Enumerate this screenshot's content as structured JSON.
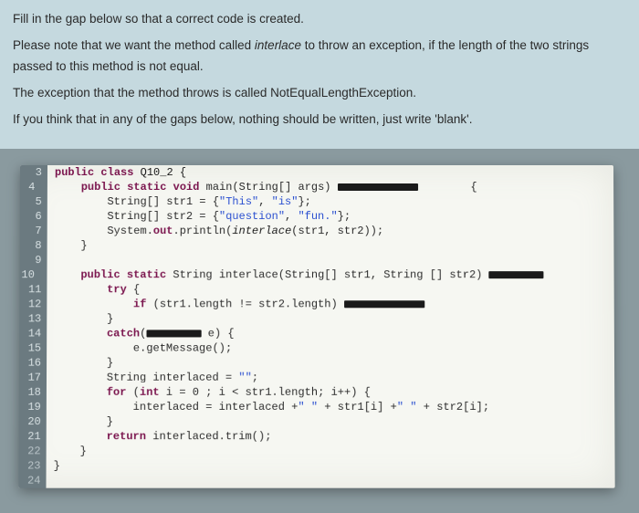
{
  "instructions": {
    "p1": "Fill in the gap below so that a correct code is created.",
    "p2a": "Please note that we want the method called ",
    "p2b": "interlace",
    "p2c": " to throw an exception, if the length of the two strings passed to this method is not equal.",
    "p3": "The exception that the method throws is called NotEqualLengthException.",
    "p4": "If you think that in any of the gaps below, nothing should be written, just write 'blank'."
  },
  "gutter": {
    "l3": "3",
    "l4": "4",
    "l5": "5",
    "l6": "6",
    "l7": "7",
    "l8": "8",
    "l9": "9",
    "l10": "10",
    "l11": "11",
    "l12": "12",
    "l13": "13",
    "l14": "14",
    "l15": "15",
    "l16": "16",
    "l17": "17",
    "l18": "18",
    "l19": "19",
    "l20": "20",
    "l21": "21",
    "l22": "22",
    "l23": "23",
    "l24": "24"
  },
  "fold": {
    "collapsed": "⊟"
  },
  "kw": {
    "public": "public",
    "class": "class",
    "static": "static",
    "void": "void",
    "try": "try",
    "if": "if",
    "catch": "catch",
    "for": "for",
    "int": "int",
    "return": "return"
  },
  "code": {
    "class_decl": " Q10_2 {",
    "main_sig_a": " main(String[] args) ",
    "main_open": "        {",
    "l5": "        String[] str1 = {",
    "l5b": ", ",
    "l5c": "};",
    "s_this": "\"This\"",
    "s_is": "\"is\"",
    "l6": "        String[] str2 = {",
    "s_question": "\"question\"",
    "s_fun": "\"fun.\"",
    "l7a": "        System.",
    "l7out": "out",
    "l7b": ".println(",
    "l7fn": "interlace",
    "l7c": "(str1, str2));",
    "l8": "    }",
    "l10a": " String ",
    "l10fn": "interlace",
    "l10b": "(String[] str1, String [] str2) ",
    "l11": " {",
    "l12a": " (str1.length != str2.length) ",
    "l13": "        }",
    "l14b": " e) {",
    "l15": "            e.getMessage();",
    "l16": "        }",
    "l17a": "        String interlaced = ",
    "s_empty": "\"\"",
    "l17b": ";",
    "l18a": " (",
    "l18b": " i = 0 ; i < str1.length; i++) {",
    "l19a": "            interlaced = interlaced +",
    "s_space": "\" \"",
    "l19b": " + str1[i] +",
    "l19c": "+ str2[i];",
    "l20": "        }",
    "l21a": " interlaced.trim();",
    "l22": "    }",
    "l23": "}"
  }
}
